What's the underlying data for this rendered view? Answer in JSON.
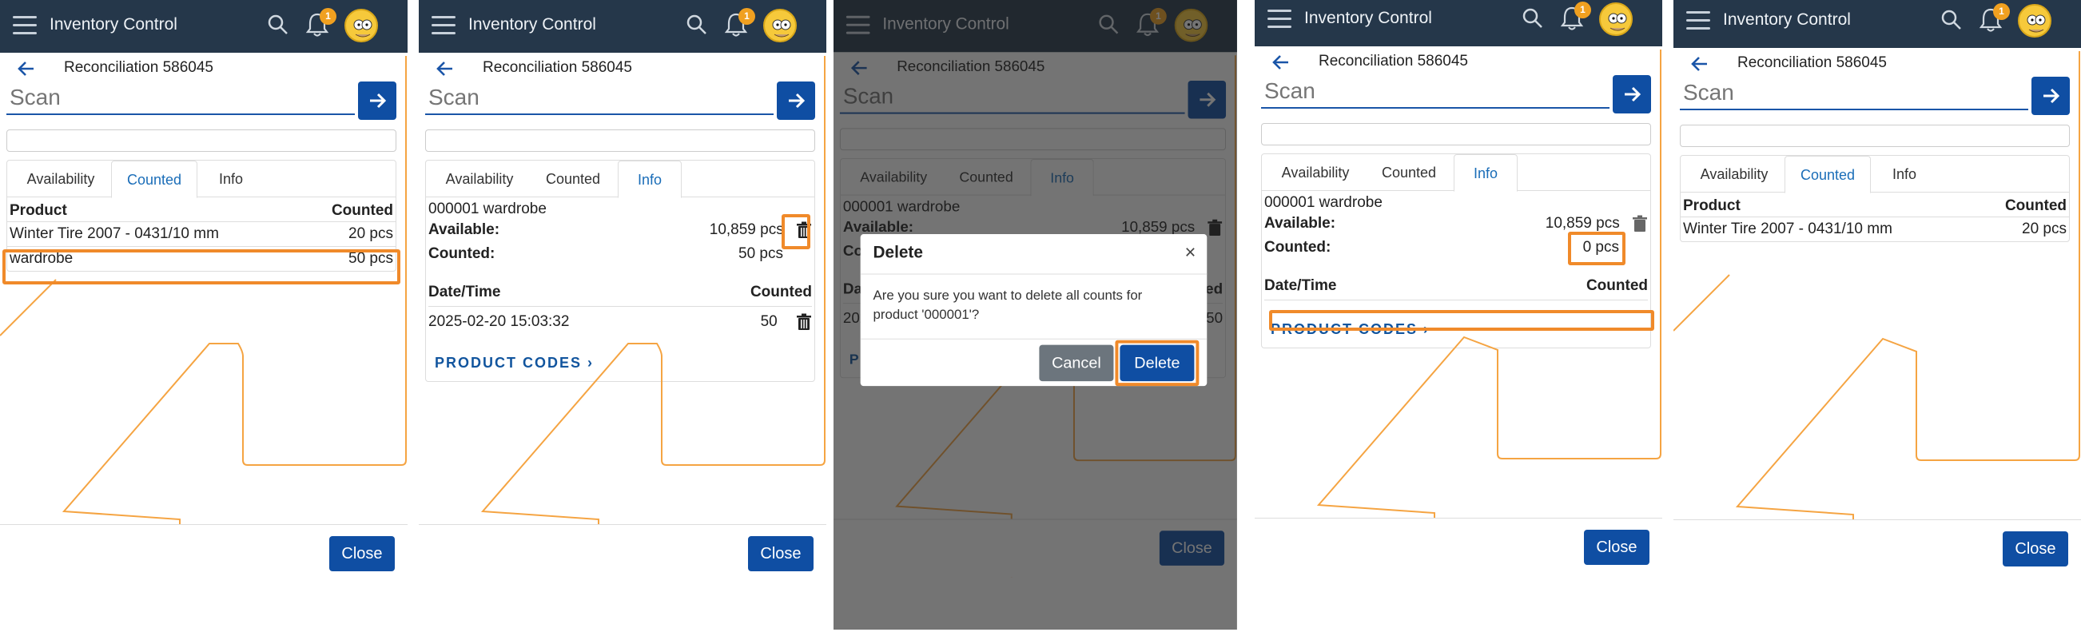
{
  "app_title": "Inventory Control",
  "notification_count": "1",
  "recon_title": "Reconciliation 586045",
  "scan_placeholder": "Scan",
  "tabs": {
    "availability": "Availability",
    "counted": "Counted",
    "info": "Info"
  },
  "counted_table": {
    "col_product": "Product",
    "col_counted": "Counted",
    "rows": [
      {
        "product": "Winter Tire 2007 - 0431/10 mm",
        "counted": "20 pcs"
      },
      {
        "product": "wardrobe",
        "counted": "50 pcs"
      }
    ]
  },
  "info": {
    "product_line": "000001 wardrobe",
    "available_label": "Available:",
    "available_value": "10,859 pcs",
    "counted_label": "Counted:",
    "counted_value": "50 pcs",
    "counted_value_after": "0 pcs",
    "history_col_datetime": "Date/Time",
    "history_col_counted": "Counted",
    "history_rows": [
      {
        "datetime": "2025-02-20 15:03:32",
        "counted": "50"
      }
    ],
    "product_codes_link": "PRODUCT CODES ›"
  },
  "dialog": {
    "title": "Delete",
    "close_glyph": "×",
    "message": "Are you sure you want to delete all counts for product '000001'?",
    "cancel_label": "Cancel",
    "delete_label": "Delete"
  },
  "close_label": "Close",
  "colors": {
    "topbar": "#25374a",
    "primary": "#0f4ea3",
    "highlight": "#f08a2a",
    "tab_active": "#1a6db8"
  },
  "icons": [
    "menu-icon",
    "search-icon",
    "bell-icon",
    "avatar",
    "back-arrow-icon",
    "arrow-right-icon",
    "trash-icon"
  ]
}
